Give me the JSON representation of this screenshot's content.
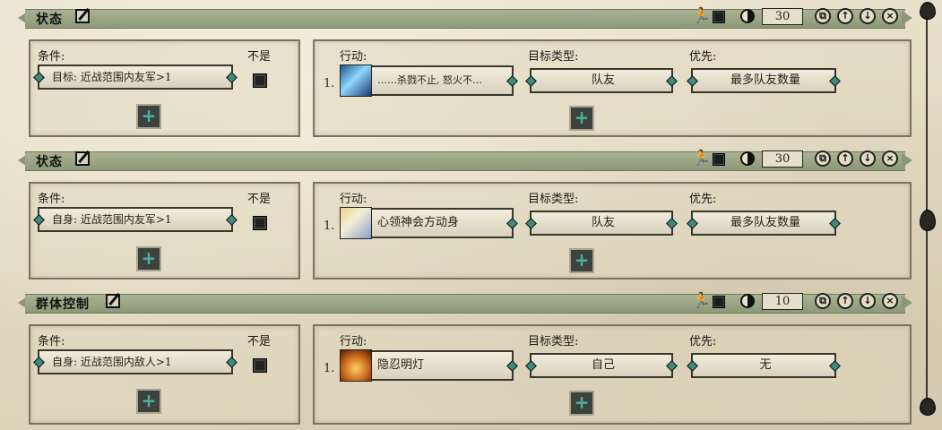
{
  "labels": {
    "condition": "条件:",
    "not": "不是",
    "action": "行动:",
    "target_type": "目标类型:",
    "priority": "优先:"
  },
  "sections": [
    {
      "title": "状态",
      "cooldown": "30",
      "condition": "目标: 近战范围内友军>1",
      "action_index": "1.",
      "action_name": "……杀戮不止, 怒火不…",
      "target_type": "队友",
      "priority": "最多队友数量"
    },
    {
      "title": "状态",
      "cooldown": "30",
      "condition": "自身: 近战范围内友军>1",
      "action_index": "1.",
      "action_name": "心领神会方动身",
      "target_type": "队友",
      "priority": "最多队友数量"
    },
    {
      "title": "群体控制",
      "cooldown": "10",
      "condition": "自身: 近战范围内敌人>1",
      "action_index": "1.",
      "action_name": "隐忍明灯",
      "target_type": "自己",
      "priority": "无"
    }
  ],
  "icons": {
    "edit": "edit-icon",
    "run": "run-icon",
    "toggle": "square-icon",
    "cooldown": "moon-icon",
    "add": "plus-icon",
    "copy": "copy-icon",
    "up": "arrow-up-icon",
    "down": "arrow-down-icon",
    "delete": "close-icon"
  },
  "colors": {
    "header_bar": "#9aa586",
    "accent": "#3d8a80",
    "run_icon": "#8a2a18"
  }
}
